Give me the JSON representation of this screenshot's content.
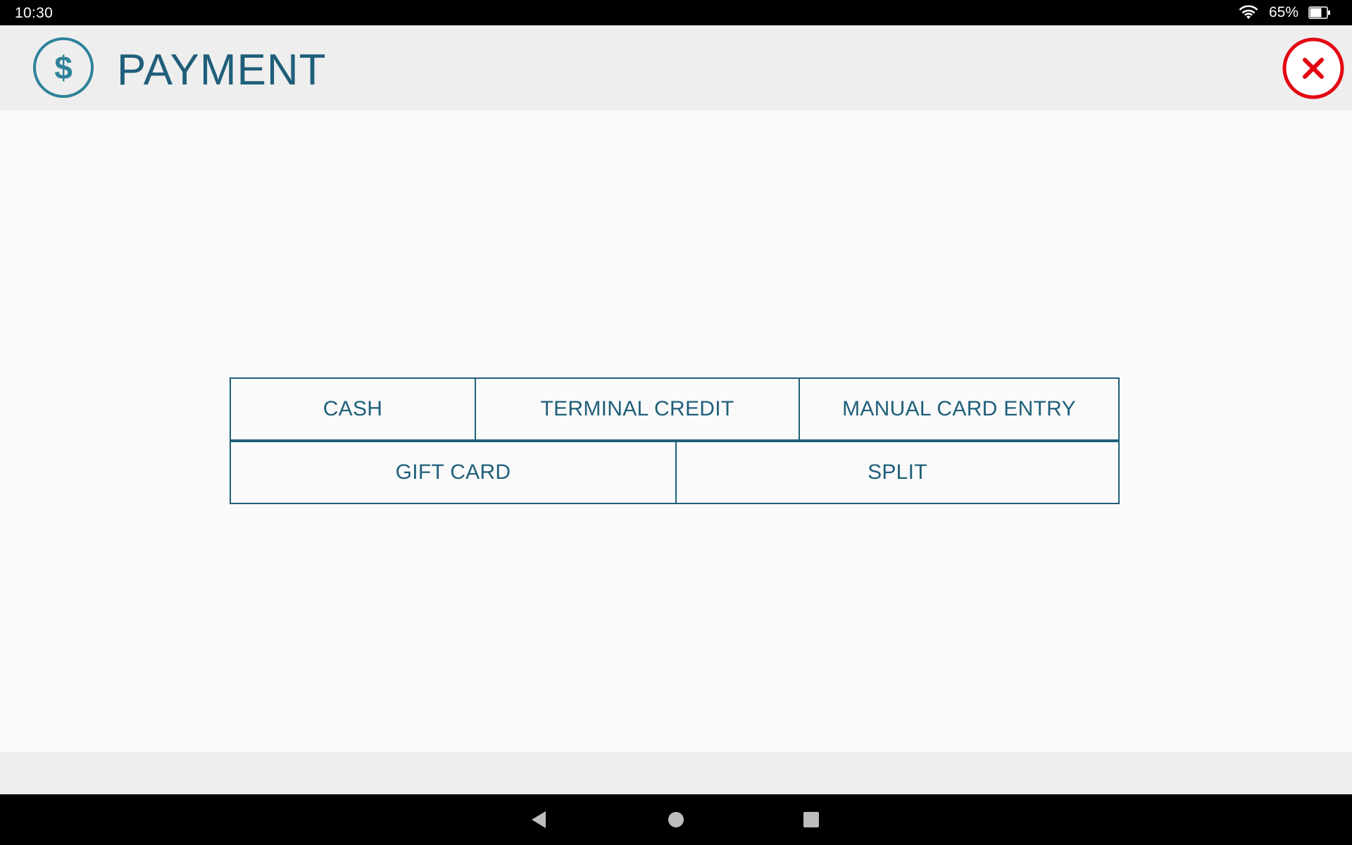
{
  "status_bar": {
    "time": "10:30",
    "battery_percent": "65%",
    "icons": [
      "wifi-icon",
      "battery-icon"
    ]
  },
  "header": {
    "title": "PAYMENT",
    "icon": "dollar-circle-icon",
    "close_icon": "close-icon"
  },
  "payment_options": {
    "row1": [
      "CASH",
      "TERMINAL CREDIT",
      "MANUAL CARD ENTRY"
    ],
    "row2": [
      "GIFT CARD",
      "SPLIT"
    ]
  },
  "nav_bar": {
    "icons": [
      "back-icon",
      "home-icon",
      "recents-icon"
    ]
  },
  "colors": {
    "accent": "#1f5f7a",
    "icon_teal": "#2e8299",
    "close_red": "#e30613",
    "header_bg": "#eeeeee",
    "content_bg": "#fafafa"
  }
}
